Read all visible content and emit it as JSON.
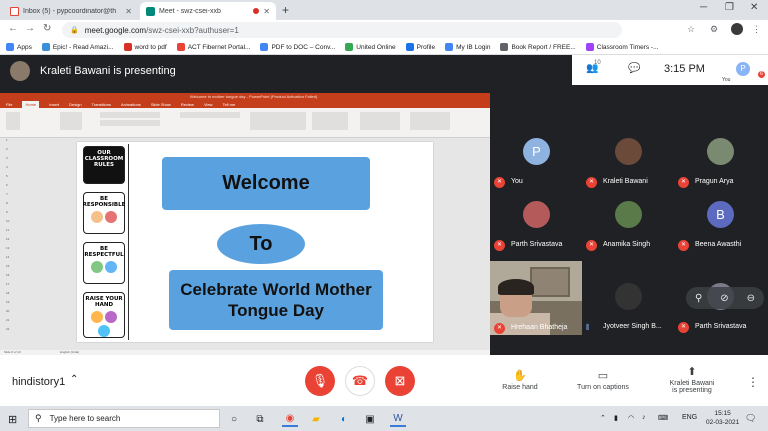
{
  "browser": {
    "tabs": [
      {
        "label": "Inbox (5) - pypcoordinator@th",
        "active": false
      },
      {
        "label": "Meet - swz-csei-xxb",
        "active": true
      }
    ],
    "new_tab": "+",
    "url_host": "meet.google.com",
    "url_path": "/swz-csei-xxb?authuser=1",
    "bookmarks": [
      {
        "label": "Apps",
        "color": "#4285f4"
      },
      {
        "label": "Epic! - Read Amazi...",
        "color": "#3a8fd9"
      },
      {
        "label": "word to pdf",
        "color": "#d93025"
      },
      {
        "label": "ACT Fibernet Portal...",
        "color": "#ea4335"
      },
      {
        "label": "PDF to DOC – Conv...",
        "color": "#4285f4"
      },
      {
        "label": "United Online",
        "color": "#34a853"
      },
      {
        "label": "Profile",
        "color": "#1a73e8"
      },
      {
        "label": "My IB Login",
        "color": "#4285f4"
      },
      {
        "label": "Book Report / FREE...",
        "color": "#5f6368"
      },
      {
        "label": "Classroom Timers -...",
        "color": "#a142f4"
      }
    ]
  },
  "meet": {
    "presenter_text": "Kraleti Bawani is presenting",
    "people_count": "10",
    "time": "3:15 PM",
    "self_initial": "P",
    "self_label": "You",
    "self_badge": "6"
  },
  "ppt": {
    "window_title": "Welcome to mother tongue day - PowerPoint (Product Activation Failed)",
    "menu": [
      "File",
      "Home",
      "Insert",
      "Design",
      "Transitions",
      "Animations",
      "Slide Show",
      "Review",
      "View",
      "Tell me"
    ],
    "active_menu": "Home",
    "status_left": "Slide 6 of 13",
    "status_lang": "English (India)"
  },
  "slide": {
    "rules": [
      {
        "text": "OUR CLASSROOM RULES"
      },
      {
        "text": "BE RESPONSIBLE"
      },
      {
        "text": "BE RESPECTFUL"
      },
      {
        "text": "RAISE YOUR HAND"
      }
    ],
    "welcome": "Welcome",
    "to": "To",
    "celebrate": "Celebrate World Mother Tongue Day"
  },
  "participants": [
    {
      "name": "You",
      "initial": "P",
      "avatar_color": "#8fb3e0",
      "photo": false,
      "muted": true
    },
    {
      "name": "Kraleti Bawani",
      "initial": "",
      "avatar_color": "#6b4a3a",
      "photo": true,
      "muted": true
    },
    {
      "name": "Pragun Arya",
      "initial": "",
      "avatar_color": "#7a8a70",
      "photo": true,
      "muted": true
    },
    {
      "name": "Parth Srivastava",
      "initial": "",
      "avatar_color": "#b55a5a",
      "photo": true,
      "muted": true
    },
    {
      "name": "Anamika Singh",
      "initial": "",
      "avatar_color": "#5a7a4a",
      "photo": true,
      "muted": true
    },
    {
      "name": "Beena Awasthi",
      "initial": "B",
      "avatar_color": "#5c6bc0",
      "photo": false,
      "muted": true
    },
    {
      "name": "Jyotveer Singh B...",
      "initial": "",
      "avatar_color": "#333333",
      "photo": true,
      "muted": false
    },
    {
      "name": "Parth Srivastava",
      "initial": "",
      "avatar_color": "#7a7a8a",
      "photo": true,
      "muted": true
    }
  ],
  "video_participant": {
    "name": "Hrehaan Bhatheja"
  },
  "controls": {
    "meeting_code": "hindistory1",
    "raise_hand": "Raise hand",
    "captions": "Turn on captions",
    "presenting": "Kraleti Bawani\nis presenting"
  },
  "taskbar": {
    "search_placeholder": "Type here to search",
    "lang": "ENG",
    "time": "15:15",
    "date": "02-03-2021"
  }
}
